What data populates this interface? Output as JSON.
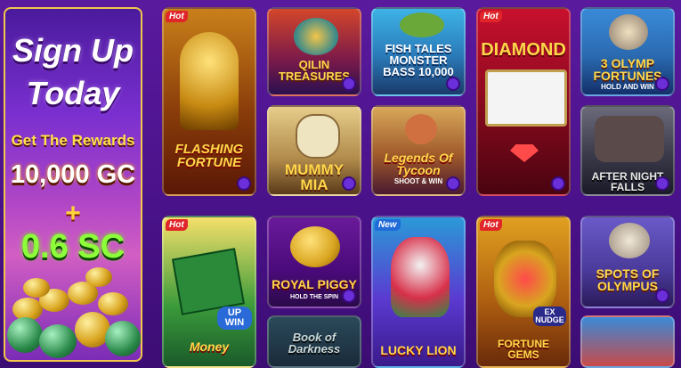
{
  "promo": {
    "line1": "Sign Up",
    "line2": "Today",
    "subtitle": "Get The Rewards",
    "gold_coins": "10,000 GC",
    "plus": "+",
    "sweeps_coins": "0.6 SC"
  },
  "badges": {
    "hot": "Hot",
    "new": "New"
  },
  "games": [
    {
      "title": "FLASHING FORTUNE",
      "badge": "Hot"
    },
    {
      "title": "QILIN TREASURES",
      "badge": ""
    },
    {
      "title": "FISH TALES MONSTER BASS 10,000",
      "badge": ""
    },
    {
      "title": "DIAMOND",
      "badge": "Hot"
    },
    {
      "title": "3 OLYMP FORTUNES",
      "sub": "HOLD AND WIN",
      "badge": ""
    },
    {
      "title": "MUMMY MIA",
      "badge": ""
    },
    {
      "title": "Legends Of Tycoon",
      "sub": "SHOOT & WIN",
      "badge": ""
    },
    {
      "title": "AFTER NIGHT FALLS",
      "badge": ""
    },
    {
      "title": "Money",
      "sub": "UP WIN",
      "badge": "Hot"
    },
    {
      "title": "ROYAL PIGGY",
      "sub": "HOLD THE SPIN",
      "badge": ""
    },
    {
      "title": "Book of Darkness",
      "badge": ""
    },
    {
      "title": "LUCKY LION",
      "badge": "New"
    },
    {
      "title": "FORTUNE GEMS",
      "sub": "EX NUDGE",
      "badge": "Hot"
    },
    {
      "title": "SPOTS OF OLYMPUS",
      "badge": ""
    }
  ],
  "colors": {
    "background": "#4a128a",
    "accent_gold": "#f0c64b",
    "sc_green": "#8dff3a",
    "fav_purple": "#6b2fd9"
  }
}
